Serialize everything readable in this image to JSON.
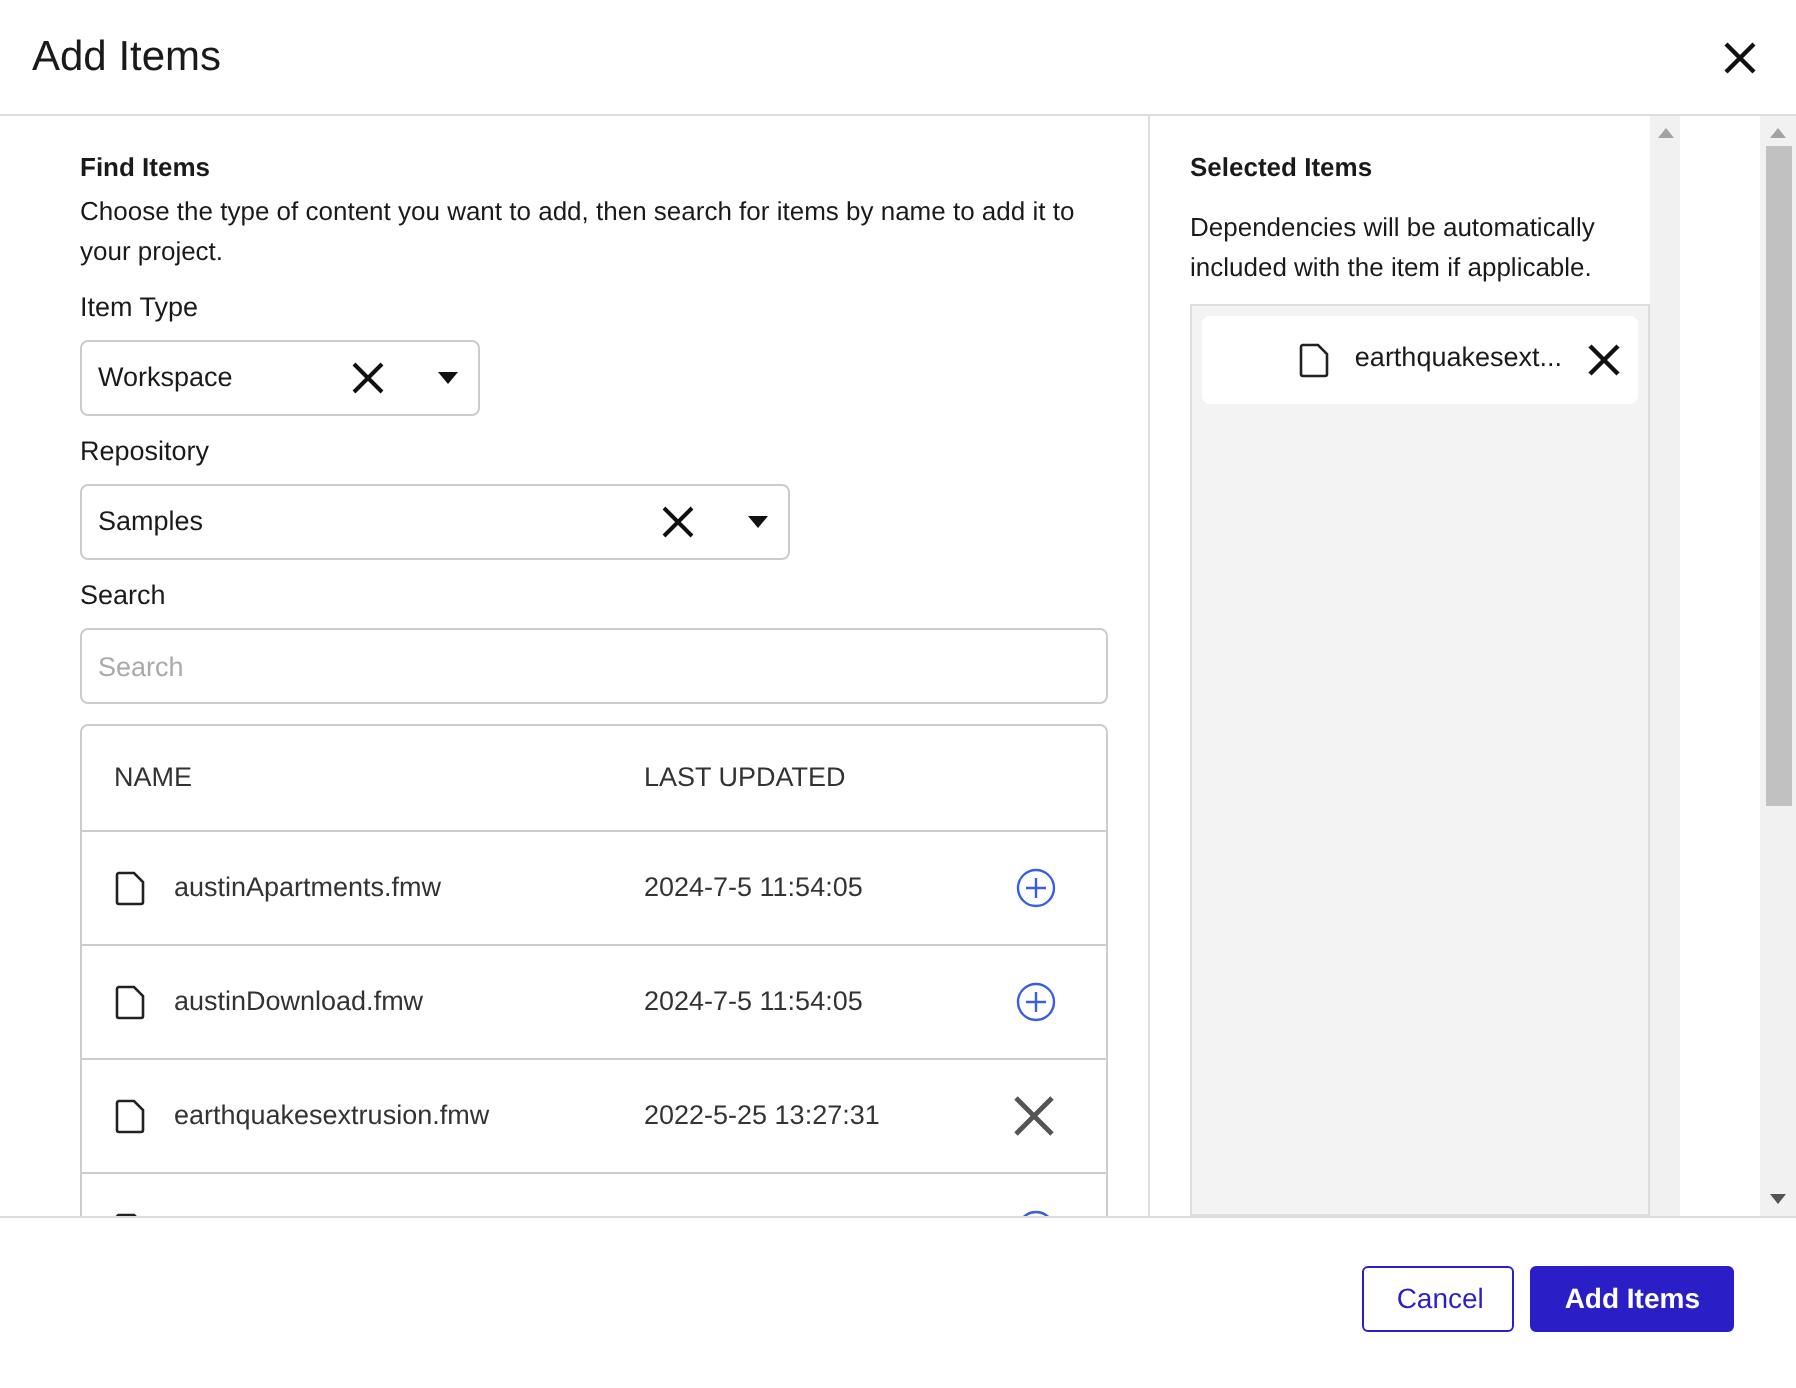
{
  "dialog": {
    "title": "Add Items"
  },
  "find_items": {
    "heading": "Find Items",
    "description": "Choose the type of content you want to add, then search for items by name to add it to your project.",
    "item_type": {
      "label": "Item Type",
      "value": "Workspace"
    },
    "repository": {
      "label": "Repository",
      "value": "Samples"
    },
    "search": {
      "label": "Search",
      "placeholder": "Search"
    },
    "table": {
      "columns": [
        "NAME",
        "LAST UPDATED"
      ],
      "rows": [
        {
          "name": "austinApartments.fmw",
          "last_updated": "2024-7-5 11:54:05",
          "selected": false
        },
        {
          "name": "austinDownload.fmw",
          "last_updated": "2024-7-5 11:54:05",
          "selected": false
        },
        {
          "name": "earthquakesextrusion.fmw",
          "last_updated": "2022-5-25 13:27:31",
          "selected": true
        },
        {
          "selected": false
        }
      ]
    }
  },
  "selected_items": {
    "heading": "Selected Items",
    "description": "Dependencies will be automatically included with the item if applicable.",
    "items": [
      {
        "name": "earthquakesext..."
      }
    ]
  },
  "buttons": [
    {
      "label": "Cancel",
      "kind": "secondary"
    },
    {
      "label": "Add Items",
      "kind": "primary"
    }
  ]
}
